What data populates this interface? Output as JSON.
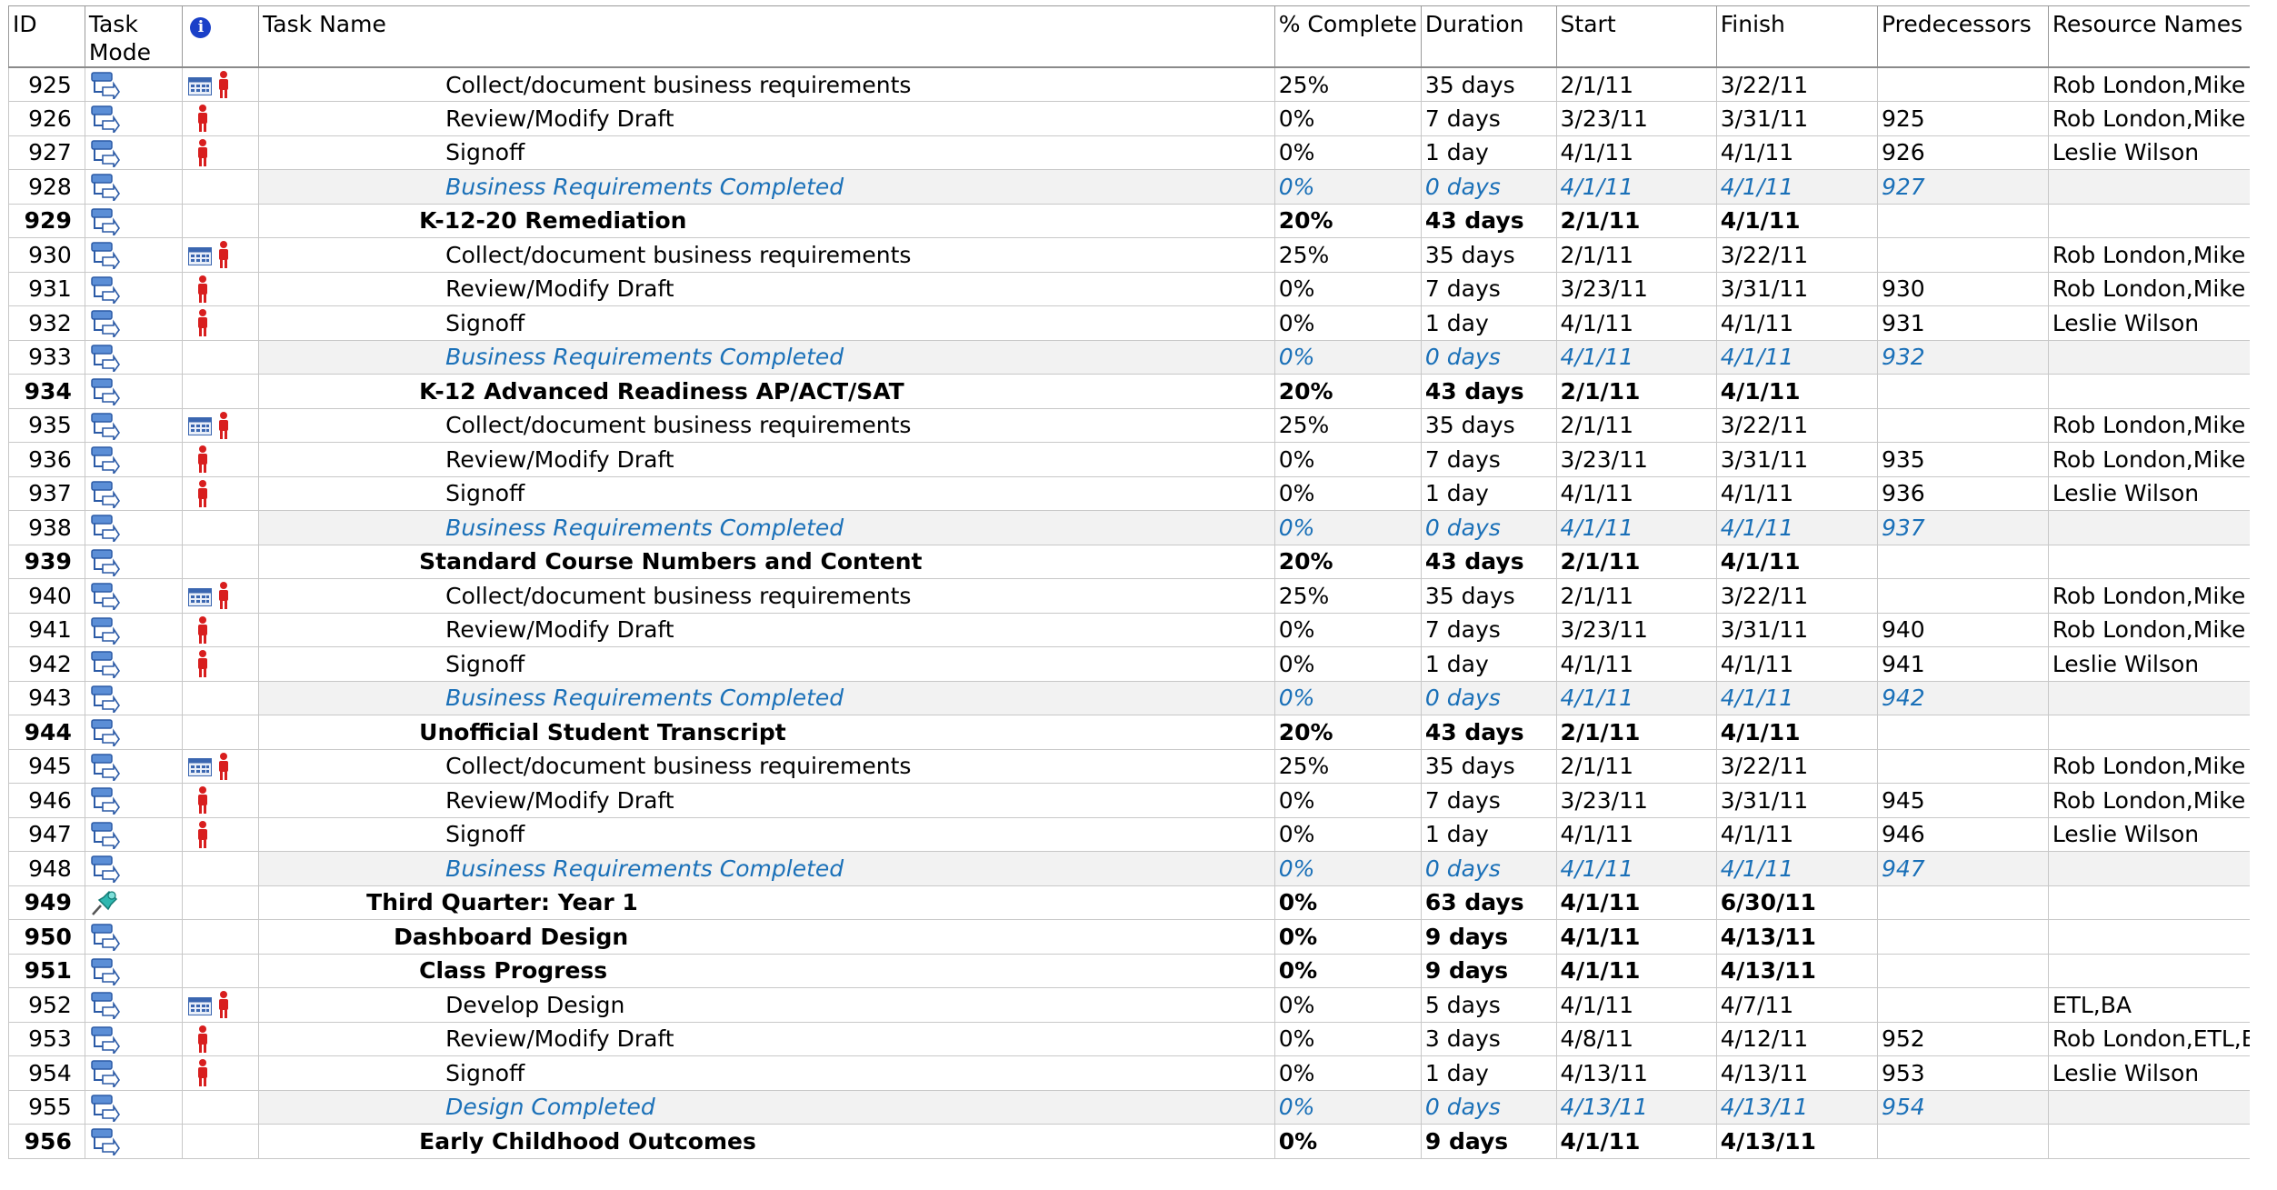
{
  "columns": {
    "id": "ID",
    "task_mode": "Task Mode",
    "indicators": "i",
    "task_name": "Task Name",
    "percent_complete": "% Complete",
    "duration": "Duration",
    "start": "Start",
    "finish": "Finish",
    "predecessors": "Predecessors",
    "resource_names": "Resource Names"
  },
  "rows": [
    {
      "id": "925",
      "type": "task",
      "level": 4,
      "indicators": [
        "calendar",
        "resource"
      ],
      "name": "Collect/document business requirements",
      "pct": "25%",
      "duration": "35 days",
      "start": "2/1/11",
      "finish": "3/22/11",
      "pred": "",
      "resources": "Rob London,Mike C"
    },
    {
      "id": "926",
      "type": "task",
      "level": 4,
      "indicators": [
        "resource"
      ],
      "name": "Review/Modify Draft",
      "pct": "0%",
      "duration": "7 days",
      "start": "3/23/11",
      "finish": "3/31/11",
      "pred": "925",
      "resources": "Rob London,Mike C"
    },
    {
      "id": "927",
      "type": "task",
      "level": 4,
      "indicators": [
        "resource"
      ],
      "name": "Signoff",
      "pct": "0%",
      "duration": "1 day",
      "start": "4/1/11",
      "finish": "4/1/11",
      "pred": "926",
      "resources": "Leslie Wilson"
    },
    {
      "id": "928",
      "type": "milestone",
      "level": 4,
      "indicators": [],
      "name": "Business Requirements Completed",
      "pct": "0%",
      "duration": "0 days",
      "start": "4/1/11",
      "finish": "4/1/11",
      "pred": "927",
      "resources": ""
    },
    {
      "id": "929",
      "type": "summary",
      "level": 3,
      "indicators": [],
      "name": "K-12-20 Remediation",
      "pct": "20%",
      "duration": "43 days",
      "start": "2/1/11",
      "finish": "4/1/11",
      "pred": "",
      "resources": ""
    },
    {
      "id": "930",
      "type": "task",
      "level": 4,
      "indicators": [
        "calendar",
        "resource"
      ],
      "name": "Collect/document business requirements",
      "pct": "25%",
      "duration": "35 days",
      "start": "2/1/11",
      "finish": "3/22/11",
      "pred": "",
      "resources": "Rob London,Mike C"
    },
    {
      "id": "931",
      "type": "task",
      "level": 4,
      "indicators": [
        "resource"
      ],
      "name": "Review/Modify Draft",
      "pct": "0%",
      "duration": "7 days",
      "start": "3/23/11",
      "finish": "3/31/11",
      "pred": "930",
      "resources": "Rob London,Mike C"
    },
    {
      "id": "932",
      "type": "task",
      "level": 4,
      "indicators": [
        "resource"
      ],
      "name": "Signoff",
      "pct": "0%",
      "duration": "1 day",
      "start": "4/1/11",
      "finish": "4/1/11",
      "pred": "931",
      "resources": "Leslie Wilson"
    },
    {
      "id": "933",
      "type": "milestone",
      "level": 4,
      "indicators": [],
      "name": "Business Requirements Completed",
      "pct": "0%",
      "duration": "0 days",
      "start": "4/1/11",
      "finish": "4/1/11",
      "pred": "932",
      "resources": ""
    },
    {
      "id": "934",
      "type": "summary",
      "level": 3,
      "indicators": [],
      "name": "K-12 Advanced Readiness AP/ACT/SAT",
      "pct": "20%",
      "duration": "43 days",
      "start": "2/1/11",
      "finish": "4/1/11",
      "pred": "",
      "resources": ""
    },
    {
      "id": "935",
      "type": "task",
      "level": 4,
      "indicators": [
        "calendar",
        "resource"
      ],
      "name": "Collect/document business requirements",
      "pct": "25%",
      "duration": "35 days",
      "start": "2/1/11",
      "finish": "3/22/11",
      "pred": "",
      "resources": "Rob London,Mike C"
    },
    {
      "id": "936",
      "type": "task",
      "level": 4,
      "indicators": [
        "resource"
      ],
      "name": "Review/Modify Draft",
      "pct": "0%",
      "duration": "7 days",
      "start": "3/23/11",
      "finish": "3/31/11",
      "pred": "935",
      "resources": "Rob London,Mike C"
    },
    {
      "id": "937",
      "type": "task",
      "level": 4,
      "indicators": [
        "resource"
      ],
      "name": "Signoff",
      "pct": "0%",
      "duration": "1 day",
      "start": "4/1/11",
      "finish": "4/1/11",
      "pred": "936",
      "resources": "Leslie Wilson"
    },
    {
      "id": "938",
      "type": "milestone",
      "level": 4,
      "indicators": [],
      "name": "Business Requirements Completed",
      "pct": "0%",
      "duration": "0 days",
      "start": "4/1/11",
      "finish": "4/1/11",
      "pred": "937",
      "resources": ""
    },
    {
      "id": "939",
      "type": "summary",
      "level": 3,
      "indicators": [],
      "name": "Standard Course Numbers and Content",
      "pct": "20%",
      "duration": "43 days",
      "start": "2/1/11",
      "finish": "4/1/11",
      "pred": "",
      "resources": ""
    },
    {
      "id": "940",
      "type": "task",
      "level": 4,
      "indicators": [
        "calendar",
        "resource"
      ],
      "name": "Collect/document business requirements",
      "pct": "25%",
      "duration": "35 days",
      "start": "2/1/11",
      "finish": "3/22/11",
      "pred": "",
      "resources": "Rob London,Mike C"
    },
    {
      "id": "941",
      "type": "task",
      "level": 4,
      "indicators": [
        "resource"
      ],
      "name": "Review/Modify Draft",
      "pct": "0%",
      "duration": "7 days",
      "start": "3/23/11",
      "finish": "3/31/11",
      "pred": "940",
      "resources": "Rob London,Mike C"
    },
    {
      "id": "942",
      "type": "task",
      "level": 4,
      "indicators": [
        "resource"
      ],
      "name": "Signoff",
      "pct": "0%",
      "duration": "1 day",
      "start": "4/1/11",
      "finish": "4/1/11",
      "pred": "941",
      "resources": "Leslie Wilson"
    },
    {
      "id": "943",
      "type": "milestone",
      "level": 4,
      "indicators": [],
      "name": "Business Requirements Completed",
      "pct": "0%",
      "duration": "0 days",
      "start": "4/1/11",
      "finish": "4/1/11",
      "pred": "942",
      "resources": ""
    },
    {
      "id": "944",
      "type": "summary",
      "level": 3,
      "indicators": [],
      "name": "Unofficial Student Transcript",
      "pct": "20%",
      "duration": "43 days",
      "start": "2/1/11",
      "finish": "4/1/11",
      "pred": "",
      "resources": ""
    },
    {
      "id": "945",
      "type": "task",
      "level": 4,
      "indicators": [
        "calendar",
        "resource"
      ],
      "name": "Collect/document business requirements",
      "pct": "25%",
      "duration": "35 days",
      "start": "2/1/11",
      "finish": "3/22/11",
      "pred": "",
      "resources": "Rob London,Mike C"
    },
    {
      "id": "946",
      "type": "task",
      "level": 4,
      "indicators": [
        "resource"
      ],
      "name": "Review/Modify Draft",
      "pct": "0%",
      "duration": "7 days",
      "start": "3/23/11",
      "finish": "3/31/11",
      "pred": "945",
      "resources": "Rob London,Mike C"
    },
    {
      "id": "947",
      "type": "task",
      "level": 4,
      "indicators": [
        "resource"
      ],
      "name": "Signoff",
      "pct": "0%",
      "duration": "1 day",
      "start": "4/1/11",
      "finish": "4/1/11",
      "pred": "946",
      "resources": "Leslie Wilson"
    },
    {
      "id": "948",
      "type": "milestone",
      "level": 4,
      "indicators": [],
      "name": "Business Requirements Completed",
      "pct": "0%",
      "duration": "0 days",
      "start": "4/1/11",
      "finish": "4/1/11",
      "pred": "947",
      "resources": ""
    },
    {
      "id": "949",
      "type": "summary",
      "level": 1,
      "mode": "manual",
      "indicators": [],
      "name": "Third Quarter: Year 1",
      "pct": "0%",
      "duration": "63 days",
      "start": "4/1/11",
      "finish": "6/30/11",
      "pred": "",
      "resources": ""
    },
    {
      "id": "950",
      "type": "summary",
      "level": 2,
      "indicators": [],
      "name": "Dashboard Design",
      "pct": "0%",
      "duration": "9 days",
      "start": "4/1/11",
      "finish": "4/13/11",
      "pred": "",
      "resources": ""
    },
    {
      "id": "951",
      "type": "summary",
      "level": 3,
      "indicators": [],
      "name": "Class Progress",
      "pct": "0%",
      "duration": "9 days",
      "start": "4/1/11",
      "finish": "4/13/11",
      "pred": "",
      "resources": ""
    },
    {
      "id": "952",
      "type": "task",
      "level": 4,
      "indicators": [
        "calendar",
        "resource"
      ],
      "name": "Develop Design",
      "pct": "0%",
      "duration": "5 days",
      "start": "4/1/11",
      "finish": "4/7/11",
      "pred": "",
      "resources": "ETL,BA"
    },
    {
      "id": "953",
      "type": "task",
      "level": 4,
      "indicators": [
        "resource"
      ],
      "name": "Review/Modify Draft",
      "pct": "0%",
      "duration": "3 days",
      "start": "4/8/11",
      "finish": "4/12/11",
      "pred": "952",
      "resources": "Rob London,ETL,BA"
    },
    {
      "id": "954",
      "type": "task",
      "level": 4,
      "indicators": [
        "resource"
      ],
      "name": "Signoff",
      "pct": "0%",
      "duration": "1 day",
      "start": "4/13/11",
      "finish": "4/13/11",
      "pred": "953",
      "resources": "Leslie Wilson"
    },
    {
      "id": "955",
      "type": "milestone",
      "level": 4,
      "indicators": [],
      "name": "Design Completed",
      "pct": "0%",
      "duration": "0 days",
      "start": "4/13/11",
      "finish": "4/13/11",
      "pred": "954",
      "resources": ""
    },
    {
      "id": "956",
      "type": "summary",
      "level": 3,
      "indicators": [],
      "name": "Early Childhood Outcomes",
      "pct": "0%",
      "duration": "9 days",
      "start": "4/1/11",
      "finish": "4/13/11",
      "pred": "",
      "resources": ""
    }
  ]
}
